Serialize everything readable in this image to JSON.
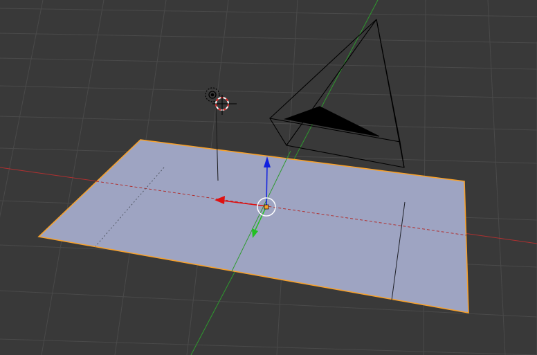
{
  "viewport": {
    "background": "#393939",
    "grid_color": "#4a4a4a",
    "x_axis_color": "#b03030",
    "y_axis_color": "#2e9a2e"
  },
  "scene": {
    "plane": {
      "name": "plane",
      "fill": "#9ea4c2",
      "outline": "#f7a12c",
      "selected": true
    },
    "camera": {
      "name": "camera",
      "line_color": "#000000"
    },
    "lamp": {
      "name": "lamp",
      "color": "#000000"
    },
    "cursor_3d": {
      "name": "3d-cursor",
      "ring_colors": [
        "#ff0000",
        "#ffffff"
      ]
    }
  },
  "gizmo": {
    "mode": "translate",
    "x_handle_color": "#e01010",
    "y_handle_color": "#22c022",
    "z_handle_color": "#1020e0",
    "origin_color": "#f7a12c"
  },
  "icons": [
    "lamp-icon",
    "3d-cursor-icon",
    "camera-icon",
    "transform-gizmo-icon"
  ]
}
